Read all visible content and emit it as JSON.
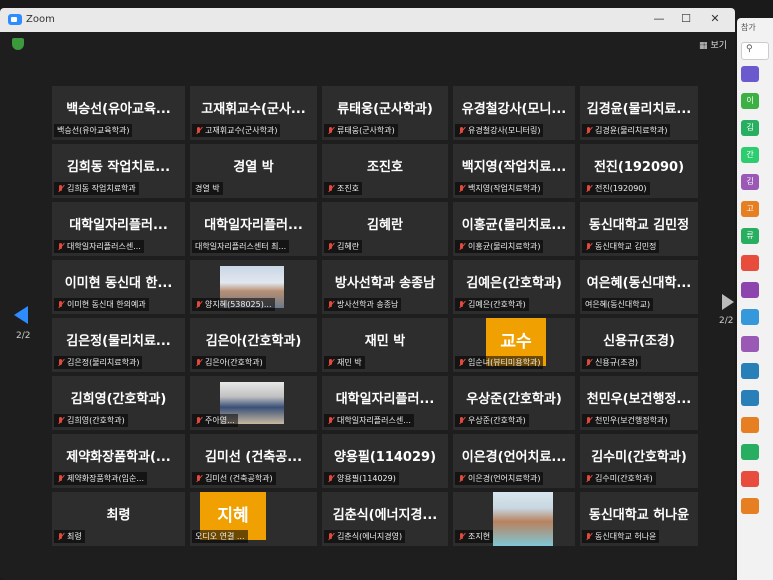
{
  "window": {
    "title": "Zoom",
    "view_label": "보기",
    "page_left": "2/2",
    "page_right": "2/2"
  },
  "side_panel": {
    "header": "참가",
    "avatars": [
      {
        "label": "",
        "color": "#6a5acd"
      },
      {
        "label": "이",
        "color": "#3cb043"
      },
      {
        "label": "김",
        "color": "#27ae60"
      },
      {
        "label": "간",
        "color": "#2ecc71"
      },
      {
        "label": "김",
        "color": "#9b59b6"
      },
      {
        "label": "고",
        "color": "#e67e22"
      },
      {
        "label": "류",
        "color": "#27ae60"
      },
      {
        "label": "",
        "color": "#e74c3c"
      },
      {
        "label": "",
        "color": "#8e44ad"
      },
      {
        "label": "",
        "color": "#3498db"
      },
      {
        "label": "",
        "color": "#9b59b6"
      },
      {
        "label": "",
        "color": "#2980b9"
      },
      {
        "label": "",
        "color": "#2980b9"
      },
      {
        "label": "",
        "color": "#e67e22"
      },
      {
        "label": "",
        "color": "#27ae60"
      },
      {
        "label": "",
        "color": "#e74c3c"
      },
      {
        "label": "",
        "color": "#e67e22"
      }
    ]
  },
  "participants": [
    {
      "display": "백승선(유아교육...",
      "name": "백승선(유아교육학과)",
      "muted": false
    },
    {
      "display": "고재휘교수(군사...",
      "name": "고재휘교수(군사학과)",
      "muted": true
    },
    {
      "display": "류태웅(군사학과)",
      "name": "류태웅(군사학과)",
      "muted": true
    },
    {
      "display": "유경철강사(모니...",
      "name": "유경철강사(모니터링)",
      "muted": true
    },
    {
      "display": "김경윤(물리치료...",
      "name": "김경윤(물리치료학과)",
      "muted": true
    },
    {
      "display": "김희동 작업치료...",
      "name": "김희동 작업치료학과",
      "muted": true
    },
    {
      "display": "경열 박",
      "name": "경열 박",
      "muted": false
    },
    {
      "display": "조진호",
      "name": "조진호",
      "muted": true
    },
    {
      "display": "백지영(작업치료...",
      "name": "백지영(작업치료학과)",
      "muted": true
    },
    {
      "display": "전진(192090)",
      "name": "전진(192090)",
      "muted": true
    },
    {
      "display": "대학일자리플러...",
      "name": "대학일자리플러스센...",
      "muted": true
    },
    {
      "display": "대학일자리플러...",
      "name": "대학일자리플러스센터 최...",
      "muted": false
    },
    {
      "display": "김혜란",
      "name": "김혜란",
      "muted": true
    },
    {
      "display": "이홍균(물리치료...",
      "name": "이홍균(물리치료학과)",
      "muted": true
    },
    {
      "display": "동신대학교 김민정",
      "name": "동신대학교 김민정",
      "muted": true
    },
    {
      "display": "이미현 동신대 한...",
      "name": "이미현 동신대 한의예과",
      "muted": true
    },
    {
      "display": "",
      "name": "양지혜(538025)...",
      "muted": true,
      "photo": "woman"
    },
    {
      "display": "방사선학과 송종남",
      "name": "방사선학과 송종남",
      "muted": true
    },
    {
      "display": "김예은(간호학과)",
      "name": "김예은(간호학과)",
      "muted": true
    },
    {
      "display": "여은혜(동신대학...",
      "name": "여은혜(동신대학교)",
      "muted": false
    },
    {
      "display": "김은정(물리치료...",
      "name": "김은정(물리치료학과)",
      "muted": true
    },
    {
      "display": "김은아(간호학과)",
      "name": "김은아(간호학과)",
      "muted": true
    },
    {
      "display": "재민 박",
      "name": "재민 박",
      "muted": true
    },
    {
      "display": "",
      "name": "임순녀(뷰티미용학과)",
      "muted": true,
      "badge": "교수"
    },
    {
      "display": "신용규(조경)",
      "name": "신용규(조경)",
      "muted": true
    },
    {
      "display": "김희영(간호학과)",
      "name": "김희영(간호학과)",
      "muted": true
    },
    {
      "display": "",
      "name": "주아영...",
      "muted": true,
      "photo": "man"
    },
    {
      "display": "대학일자리플러...",
      "name": "대학일자리플러스센...",
      "muted": true
    },
    {
      "display": "우상준(간호학과)",
      "name": "우상준(간호학과)",
      "muted": true
    },
    {
      "display": "천민우(보건행정...",
      "name": "천민우(보건행정학과)",
      "muted": true
    },
    {
      "display": "제약화장품학과(...",
      "name": "제약화장품학과(임순...",
      "muted": true
    },
    {
      "display": "김미선 (건축공...",
      "name": "김미선 (건축공학과)",
      "muted": true
    },
    {
      "display": "양용필(114029)",
      "name": "양용필(114029)",
      "muted": true
    },
    {
      "display": "이은경(언어치료...",
      "name": "이은경(언어치료학과)",
      "muted": true
    },
    {
      "display": "김수미(간호학과)",
      "name": "김수미(간호학과)",
      "muted": true
    },
    {
      "display": "최령",
      "name": "최령",
      "muted": true
    },
    {
      "display": "",
      "name": "오디오 연결 ...",
      "muted": false,
      "badge": "지혜"
    },
    {
      "display": "김춘식(에너지경...",
      "name": "김춘식(에너지경영)",
      "muted": true
    },
    {
      "display": "",
      "name": "조지현",
      "muted": true,
      "photo": "woman2"
    },
    {
      "display": "동신대학교 허나윤",
      "name": "동신대학교 허나윤",
      "muted": true
    }
  ]
}
